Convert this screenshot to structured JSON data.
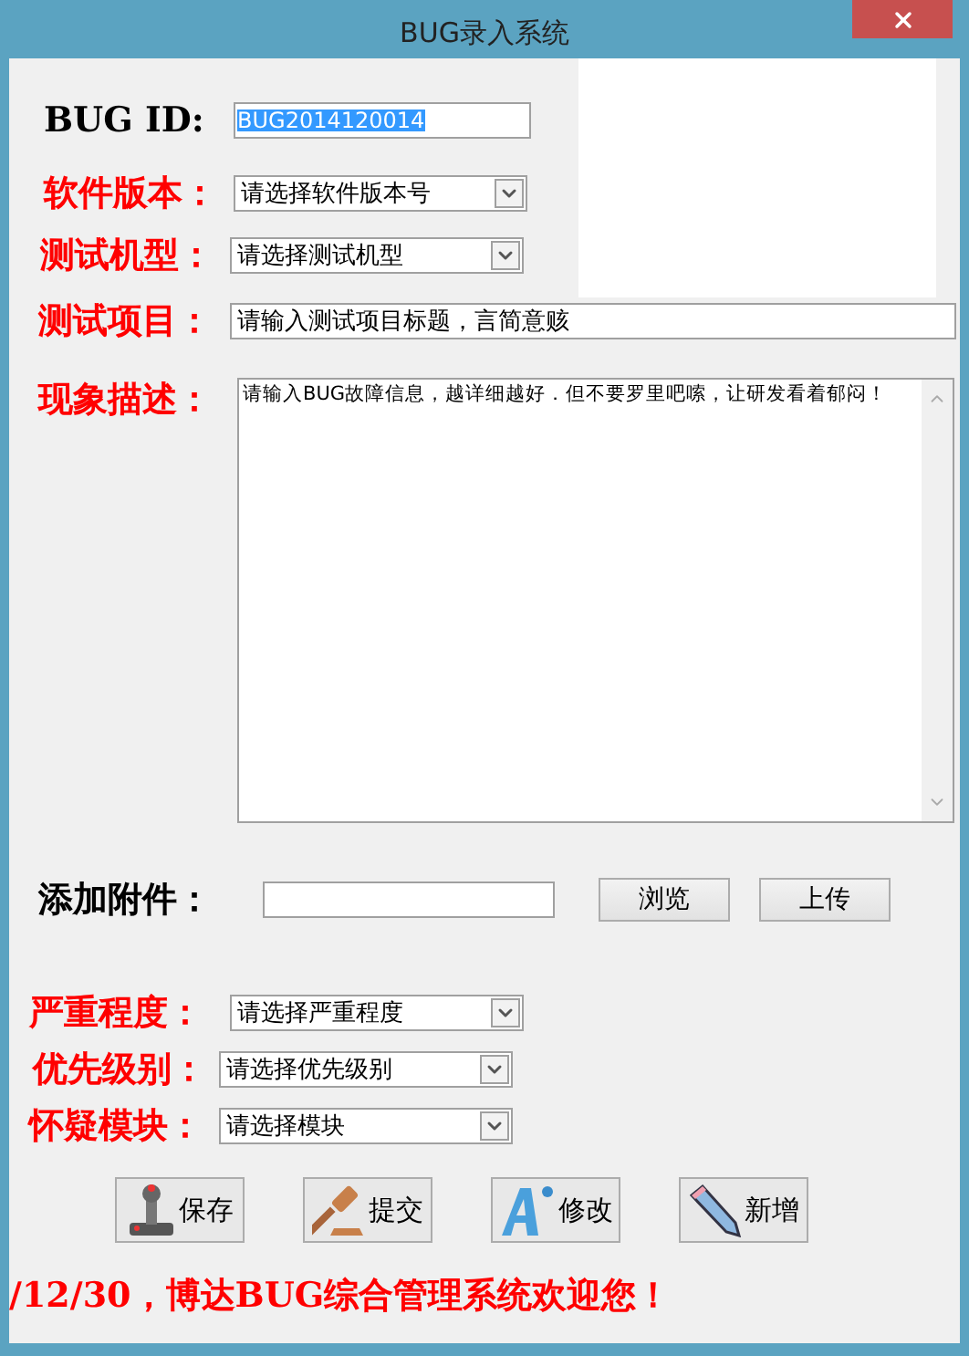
{
  "window": {
    "title": "BUG录入系统"
  },
  "top_fields": [
    {
      "kind": "text",
      "label": "BUG ID:",
      "color": "#000000",
      "value": "BUG2014120014",
      "text_selected": true
    },
    {
      "kind": "select",
      "label": "软件版本：",
      "color": "#ff0000",
      "value": "请选择软件版本号"
    },
    {
      "kind": "select",
      "label": "测试机型：",
      "color": "#ff0000",
      "value": "请选择测试机型"
    }
  ],
  "title_field": {
    "label": "测试项目：",
    "value": "请输入测试项目标题，言简意赅"
  },
  "description": {
    "label": "现象描述：",
    "value": "请输入BUG故障信息，越详细越好．但不要罗里吧嗦，让研发看着郁闷！"
  },
  "attachment": {
    "label": "添加附件：",
    "buttons": [
      "浏览",
      "上传"
    ]
  },
  "class_fields": [
    {
      "label": "严重程度：",
      "value": "请选择严重程度"
    },
    {
      "label": "优先级别：",
      "value": "请选择优先级别"
    },
    {
      "label": "怀疑模块：",
      "value": "请选择模块"
    }
  ],
  "actions": [
    {
      "kind": "joystick",
      "label": "保存"
    },
    {
      "kind": "gavel",
      "label": "提交"
    },
    {
      "kind": "font",
      "label": "修改"
    },
    {
      "kind": "pencil",
      "label": "新增"
    }
  ],
  "footer": "/12/30，博达BUG综合管理系统欢迎您！"
}
